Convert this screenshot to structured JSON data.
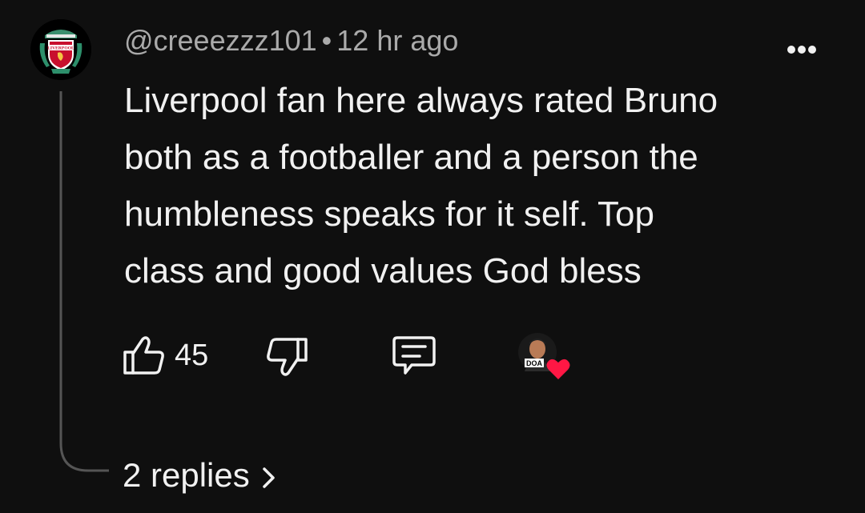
{
  "comment": {
    "author": "@creeezzz101",
    "separator": "•",
    "time_ago": "12 hr ago",
    "lines": [
      "Liverpool fan here always rated Bruno",
      "both as a footballer and a person the",
      "humbleness speaks for it self. Top",
      "class and good values God bless"
    ],
    "avatar_icon": "liverpool-crest-icon",
    "avatar_text": "LIVERPOOL"
  },
  "actions": {
    "like_count": "45",
    "like_icon": "thumbs-up-icon",
    "dislike_icon": "thumbs-down-icon",
    "reply_icon": "comment-icon",
    "creator_badge_text": "DOA",
    "creator_heart_icon": "heart-icon"
  },
  "replies": {
    "label": "2 replies",
    "chevron_icon": "chevron-right-icon"
  },
  "colors": {
    "background": "#0f0f0f",
    "primary_text": "#f1f1f1",
    "secondary_text": "#aaaaaa",
    "heart": "#ff1744",
    "thread_line": "#555555"
  }
}
